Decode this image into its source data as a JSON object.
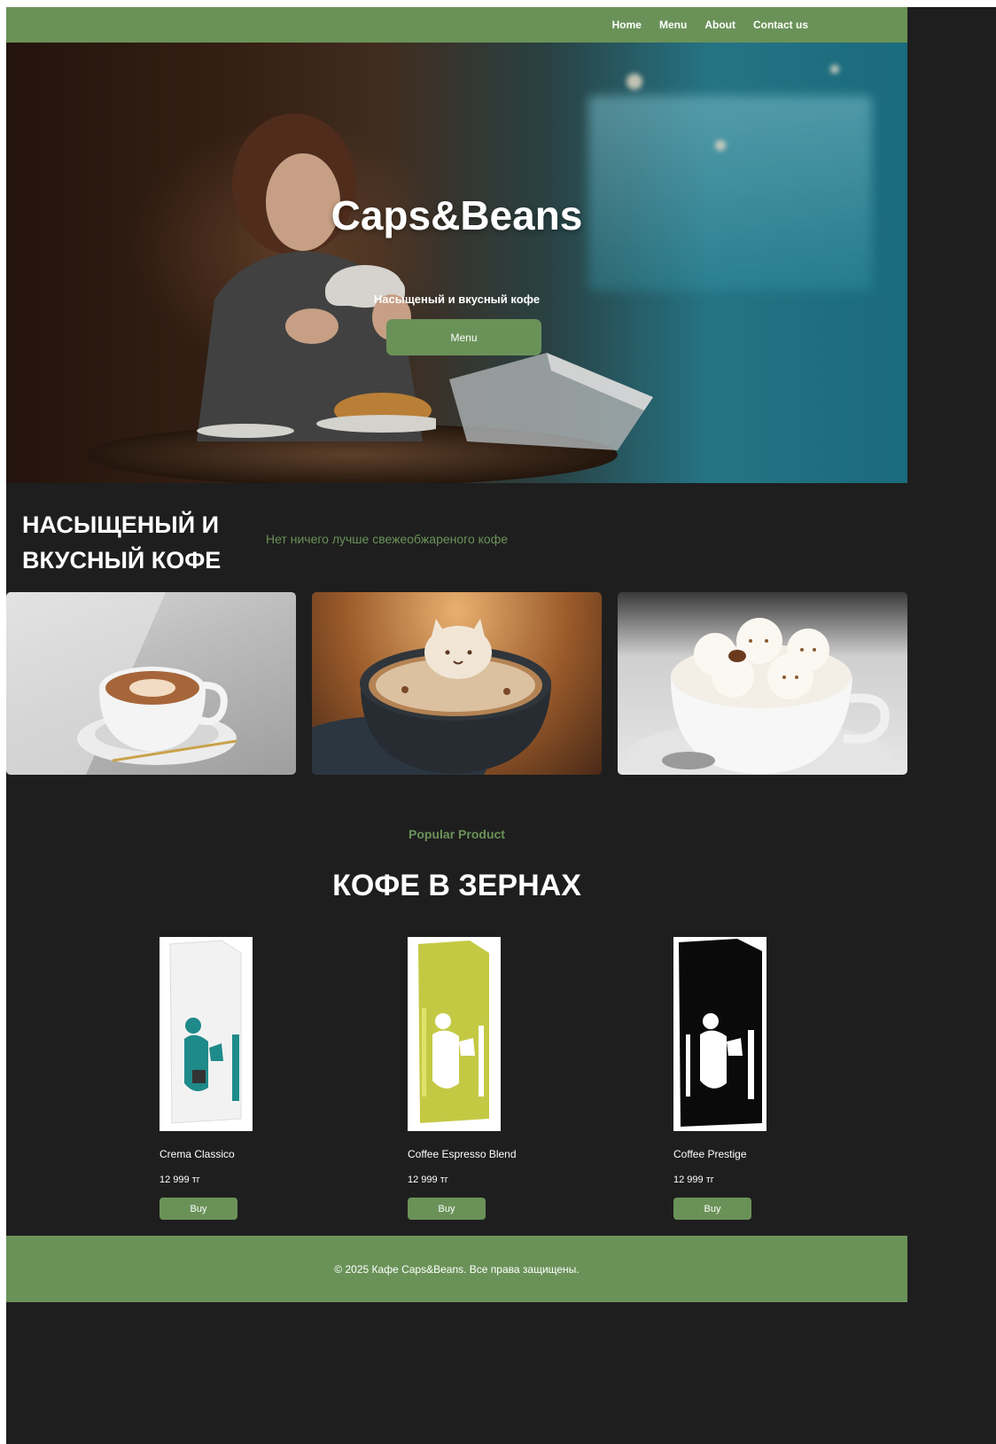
{
  "nav": {
    "links": [
      "Home",
      "Menu",
      "About",
      "Contact us"
    ]
  },
  "hero": {
    "title": "Caps&Beans",
    "subtitle": "Насыщеный и вкусный кофе",
    "button_label": "Menu"
  },
  "intro": {
    "heading": "НАСЫЩЕНЫЙ И ВКУСНЫЙ КОФЕ",
    "tagline": "Нет ничего лучше свежеобжареного кофе"
  },
  "gallery": {
    "items": [
      "latte-art-cup",
      "cat-foam-cappuccino",
      "cat-foam-cups"
    ]
  },
  "products_section": {
    "label": "Popular Product",
    "title": "КОФЕ В ЗЕРНАХ",
    "items": [
      {
        "name": "Crema Classico",
        "price": "12 999 тг",
        "buy_label": "Buy",
        "bag_color": "#ffffff",
        "accent": "#1f8a8a"
      },
      {
        "name": "Coffee Espresso Blend",
        "price": "12 999 тг",
        "buy_label": "Buy",
        "bag_color": "#c4c944",
        "accent": "#ffffff"
      },
      {
        "name": "Coffee Prestige",
        "price": "12 999 тг",
        "buy_label": "Buy",
        "bag_color": "#0a0a0a",
        "accent": "#ffffff"
      }
    ]
  },
  "footer": {
    "text": "© 2025 Кафе Caps&Beans. Все права защищены."
  },
  "colors": {
    "accent": "#6a9258",
    "background": "#1e1e1e"
  }
}
